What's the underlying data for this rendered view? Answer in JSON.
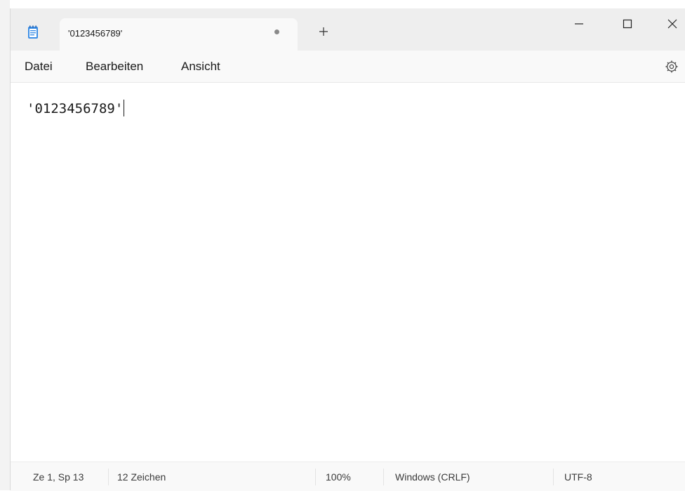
{
  "tab": {
    "title": "'0123456789'",
    "modified": true,
    "new_tab_glyph": "+",
    "icon": "notepad-icon"
  },
  "window_controls": {
    "minimize": "—",
    "maximize": "☐",
    "close": "✕"
  },
  "menu": {
    "items": [
      {
        "label": "Datei"
      },
      {
        "label": "Bearbeiten"
      },
      {
        "label": "Ansicht"
      }
    ],
    "settings_icon": "gear-icon"
  },
  "editor": {
    "content": "'0123456789'"
  },
  "status": {
    "position": "Ze 1, Sp 13",
    "char_count": "12 Zeichen",
    "zoom": "100%",
    "line_ending": "Windows (CRLF)",
    "encoding": "UTF-8"
  },
  "colors": {
    "titlebar_bg": "#eeeeee",
    "tab_bg": "#f9f9f9",
    "notepad_icon": "#1e73d8"
  }
}
